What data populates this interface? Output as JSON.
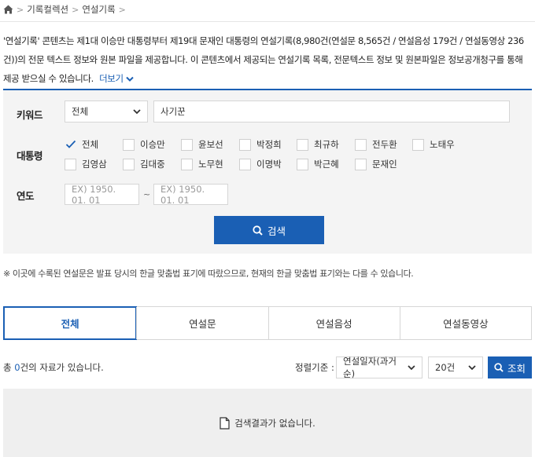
{
  "breadcrumb": {
    "home_icon": "home-icon",
    "items": [
      "기록컬렉션",
      "연설기록"
    ]
  },
  "intro": {
    "text": "'연설기록' 콘텐츠는 제1대 이승만 대통령부터 제19대 문재인 대통령의 연설기록(8,980건(연설문 8,565건 / 연설음성 179건 / 연설동영상 236건))의 전문 텍스트 정보와 원본 파일을 제공합니다. 이 콘텐츠에서 제공되는 연설기록 목록, 전문텍스트 정보 및 원본파일은 정보공개청구를 통해 제공 받으실 수 있습니다.",
    "more_label": "더보기"
  },
  "search": {
    "keyword_label": "키워드",
    "keyword_scope": "전체",
    "keyword_value": "사기꾼",
    "president_label": "대통령",
    "presidents": [
      {
        "name": "전체",
        "checked": true
      },
      {
        "name": "이승만",
        "checked": false
      },
      {
        "name": "윤보선",
        "checked": false
      },
      {
        "name": "박정희",
        "checked": false
      },
      {
        "name": "최규하",
        "checked": false
      },
      {
        "name": "전두환",
        "checked": false
      },
      {
        "name": "노태우",
        "checked": false
      },
      {
        "name": "김영삼",
        "checked": false
      },
      {
        "name": "김대중",
        "checked": false
      },
      {
        "name": "노무현",
        "checked": false
      },
      {
        "name": "이명박",
        "checked": false
      },
      {
        "name": "박근혜",
        "checked": false
      },
      {
        "name": "문재인",
        "checked": false
      }
    ],
    "year_label": "연도",
    "year_from_placeholder": "EX) 1950. 01. 01",
    "year_to_placeholder": "EX) 1950. 01. 01",
    "range_separator": "~",
    "search_button": "검색"
  },
  "notice": "※ 이곳에 수록된 연설문은 발표 당시의 한글 맞춤법 표기에 따랐으므로, 현재의 한글 맞춤법 표기와는 다를 수 있습니다.",
  "tabs": [
    {
      "label": "전체",
      "active": true
    },
    {
      "label": "연설문",
      "active": false
    },
    {
      "label": "연설음성",
      "active": false
    },
    {
      "label": "연설동영상",
      "active": false
    }
  ],
  "results": {
    "count_prefix": "총 ",
    "count": "0",
    "count_suffix": "건의 자료가 있습니다.",
    "sort_label": "정렬기준 :",
    "sort_value": "연설일자(과거순)",
    "page_size": "20건",
    "inquire_button": "조회",
    "empty_message": "검색결과가 없습니다."
  },
  "colors": {
    "accent": "#1a5fb4",
    "panel": "#f4f4f4",
    "empty_panel": "#efefef"
  }
}
